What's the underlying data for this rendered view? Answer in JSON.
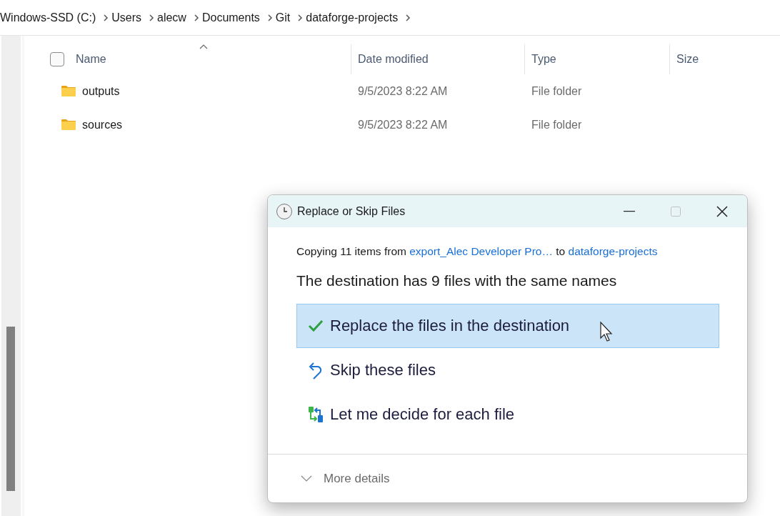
{
  "breadcrumb": [
    "Windows-SSD (C:)",
    "Users",
    "alecw",
    "Documents",
    "Git",
    "dataforge-projects"
  ],
  "file_list": {
    "select_all_checked": false,
    "columns": [
      {
        "label": "Name",
        "sorted": true
      },
      {
        "label": "Date modified",
        "sorted": false
      },
      {
        "label": "Type",
        "sorted": false
      },
      {
        "label": "Size",
        "sorted": false
      }
    ],
    "rows": [
      {
        "name": "outputs",
        "date_modified": "9/5/2023 8:22 AM",
        "type": "File folder"
      },
      {
        "name": "sources",
        "date_modified": "9/5/2023 8:22 AM",
        "type": "File folder"
      }
    ]
  },
  "dialog": {
    "title": "Replace or Skip Files",
    "copy_prefix": "Copying 11 items from",
    "source_link": "export_Alec Developer Pro…",
    "copy_middle": "to",
    "destination_link": "dataforge-projects",
    "heading": "The destination has 9 files with the same names",
    "options": [
      {
        "kind": "replace",
        "label": "Replace the files in the destination",
        "selected": true
      },
      {
        "kind": "skip",
        "label": "Skip these files",
        "selected": false
      },
      {
        "kind": "decide",
        "label": "Let me decide for each file",
        "selected": false
      }
    ],
    "more_details": "More details"
  }
}
